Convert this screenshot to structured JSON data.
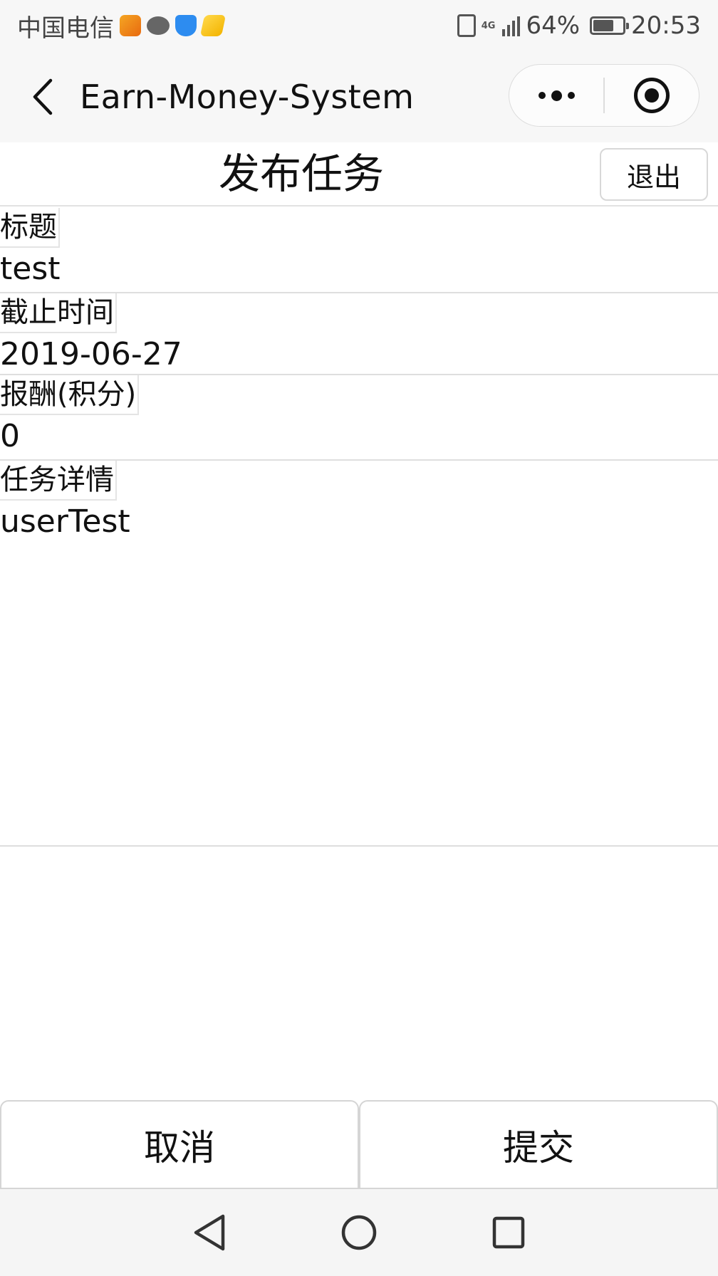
{
  "status_bar": {
    "carrier": "中国电信",
    "network_type": "4G",
    "battery_percent": "64%",
    "battery_level": 0.64,
    "time": "20:53",
    "notification_icons": [
      "go-app-icon",
      "chat-bubble-icon",
      "shield-icon",
      "payment-icon"
    ]
  },
  "nav_bar": {
    "title": "Earn-Money-System"
  },
  "page": {
    "title": "发布任务",
    "logout_label": "退出"
  },
  "form": {
    "title_label": "标题",
    "title_value": "test",
    "deadline_label": "截止时间",
    "deadline_value": "2019-06-27",
    "reward_label": "报酬(积分)",
    "reward_value": "0",
    "detail_label": "任务详情",
    "detail_value": "userTest"
  },
  "actions": {
    "cancel_label": "取消",
    "submit_label": "提交"
  }
}
